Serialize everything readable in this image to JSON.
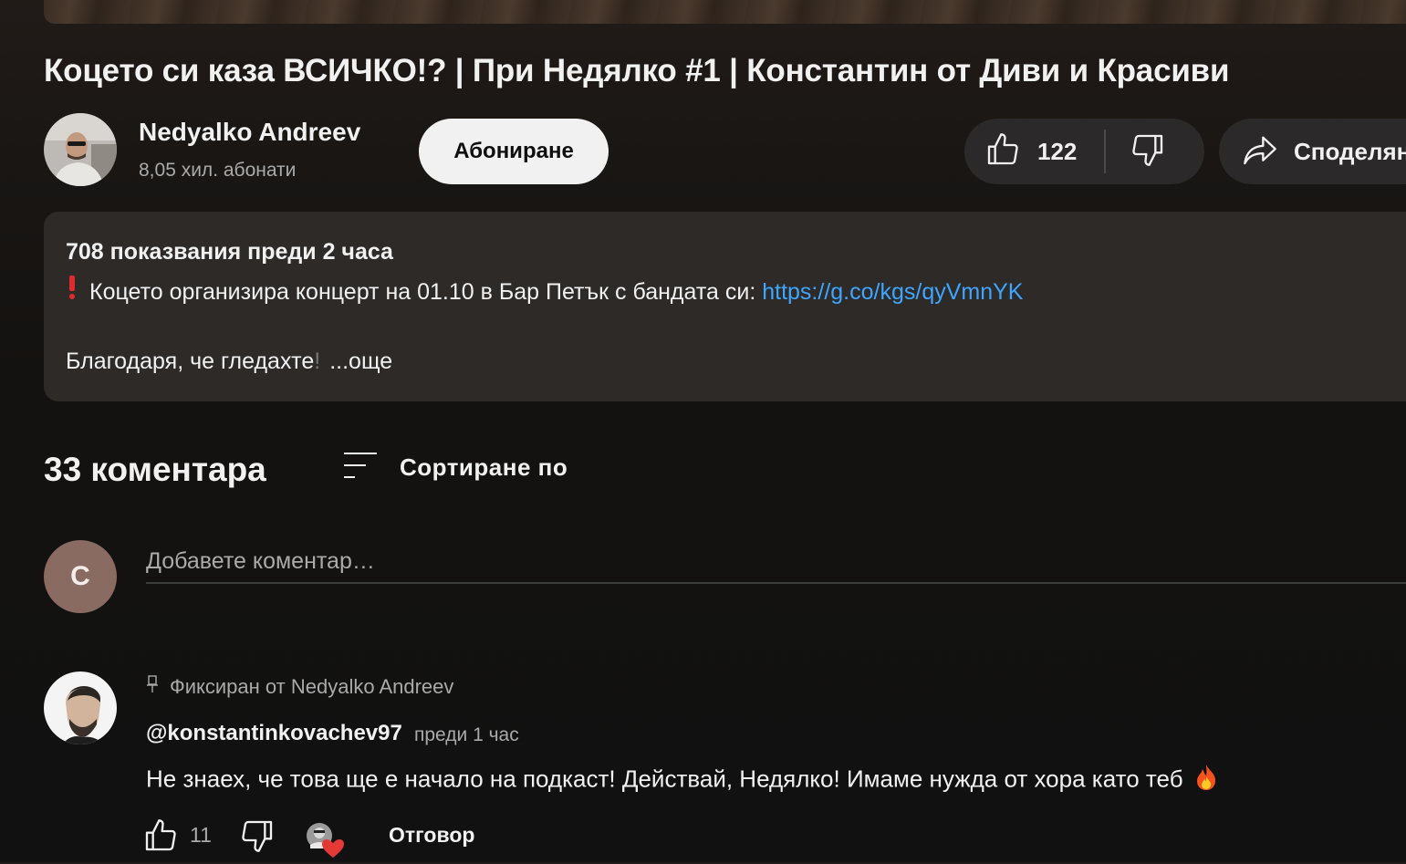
{
  "video": {
    "title": "Коцето си каза ВСИЧКО!? | При Недялко #1 | Константин от Диви и Красиви"
  },
  "channel": {
    "name": "Nedyalko Andreev",
    "subscribers": "8,05 хил. абонати",
    "subscribe_label": "Абониране"
  },
  "actions": {
    "like_count": "122",
    "share_label": "Споделяне"
  },
  "description": {
    "meta": "708 показвания  преди 2 часа",
    "line1_text": "Коцето организира концерт на 01.10 в Бар Петък с бандата си: ",
    "link": "https://g.co/kgs/qyVmnYK",
    "line2_text": "Благодаря, че гледахте",
    "line2_fade": "!",
    "more": "...още"
  },
  "comments": {
    "count_label": "33 коментара",
    "sort_label": "Сортиране по",
    "current_user_initial": "C",
    "input_placeholder": "Добавете коментар…",
    "pinned_comment": {
      "pinned_label": "Фиксиран от Nedyalko Andreev",
      "author": "@konstantinkovachev97",
      "time": "преди 1 час",
      "text": "Не знаех, че това ще е начало на подкаст! Действай, Недялко! Имаме нужда от хора като теб",
      "like_count": "11",
      "reply_label": "Отговор"
    }
  },
  "colors": {
    "link": "#3ea6ff",
    "heart": "#e53935",
    "avatar_user": "#8a6b61"
  }
}
